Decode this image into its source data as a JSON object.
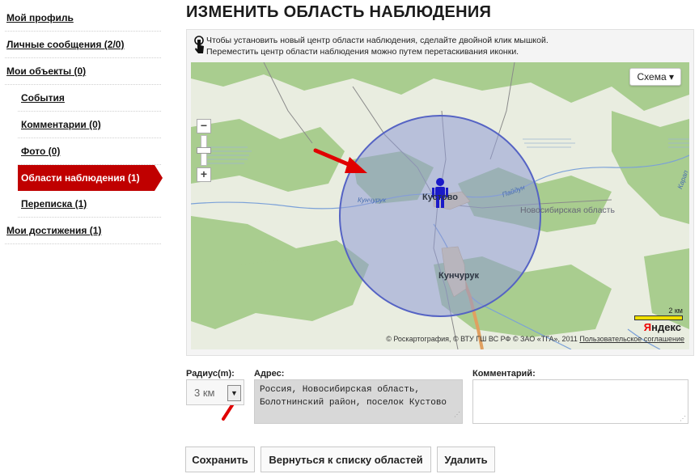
{
  "sidebar": {
    "items": [
      {
        "label": "Мой профиль"
      },
      {
        "label": "Личные сообщения (2/0)"
      },
      {
        "label": "Мои объекты  (0)"
      },
      {
        "label": "События"
      },
      {
        "label": "Комментарии (0)"
      },
      {
        "label": "Фото (0)"
      },
      {
        "label": "Области наблюдения (1)"
      },
      {
        "label": "Переписка (1)"
      },
      {
        "label": "Мои достижения  (1)"
      }
    ]
  },
  "page": {
    "title": "ИЗМЕНИТЬ ОБЛАСТЬ НАБЛЮДЕНИЯ"
  },
  "map": {
    "hint_line1": "Чтобы установить новый центр области наблюдения, сделайте двойной клик мышкой.",
    "hint_line2": "Переместить центр области наблюдения можно путем перетаскивания иконки.",
    "scheme_button": "Схема",
    "labels": {
      "kustovo": "Кустово",
      "kunchuruk": "Кунчурук",
      "region": "Новосибирская область",
      "river1": "Кунчурук",
      "river2": "Пайдун",
      "edge": "Карап"
    },
    "scale_label": "2 км",
    "yandex_y": "Я",
    "yandex_rest": "ндекс",
    "copyright": "© Роскартография, © ВТУ ГШ ВС РФ © ЗАО «ТГА», 2011",
    "terms_link": "Пользовательское соглашение",
    "colors": {
      "circle_fill": "#8f9bd6",
      "circle_stroke": "#5563c4",
      "forest": "#a8cc8c",
      "marker": "#1a1ac8"
    }
  },
  "form": {
    "radius_label": "Радиус(m):",
    "radius_value": "3 км",
    "address_label": "Адрес:",
    "address_line1": "Россия, Новосибирская область,",
    "address_line2": "Болотнинский район, поселок Кустово",
    "comment_label": "Комментарий:"
  },
  "buttons": {
    "save": "Сохранить",
    "back": "Вернуться к списку областей",
    "delete": "Удалить"
  }
}
